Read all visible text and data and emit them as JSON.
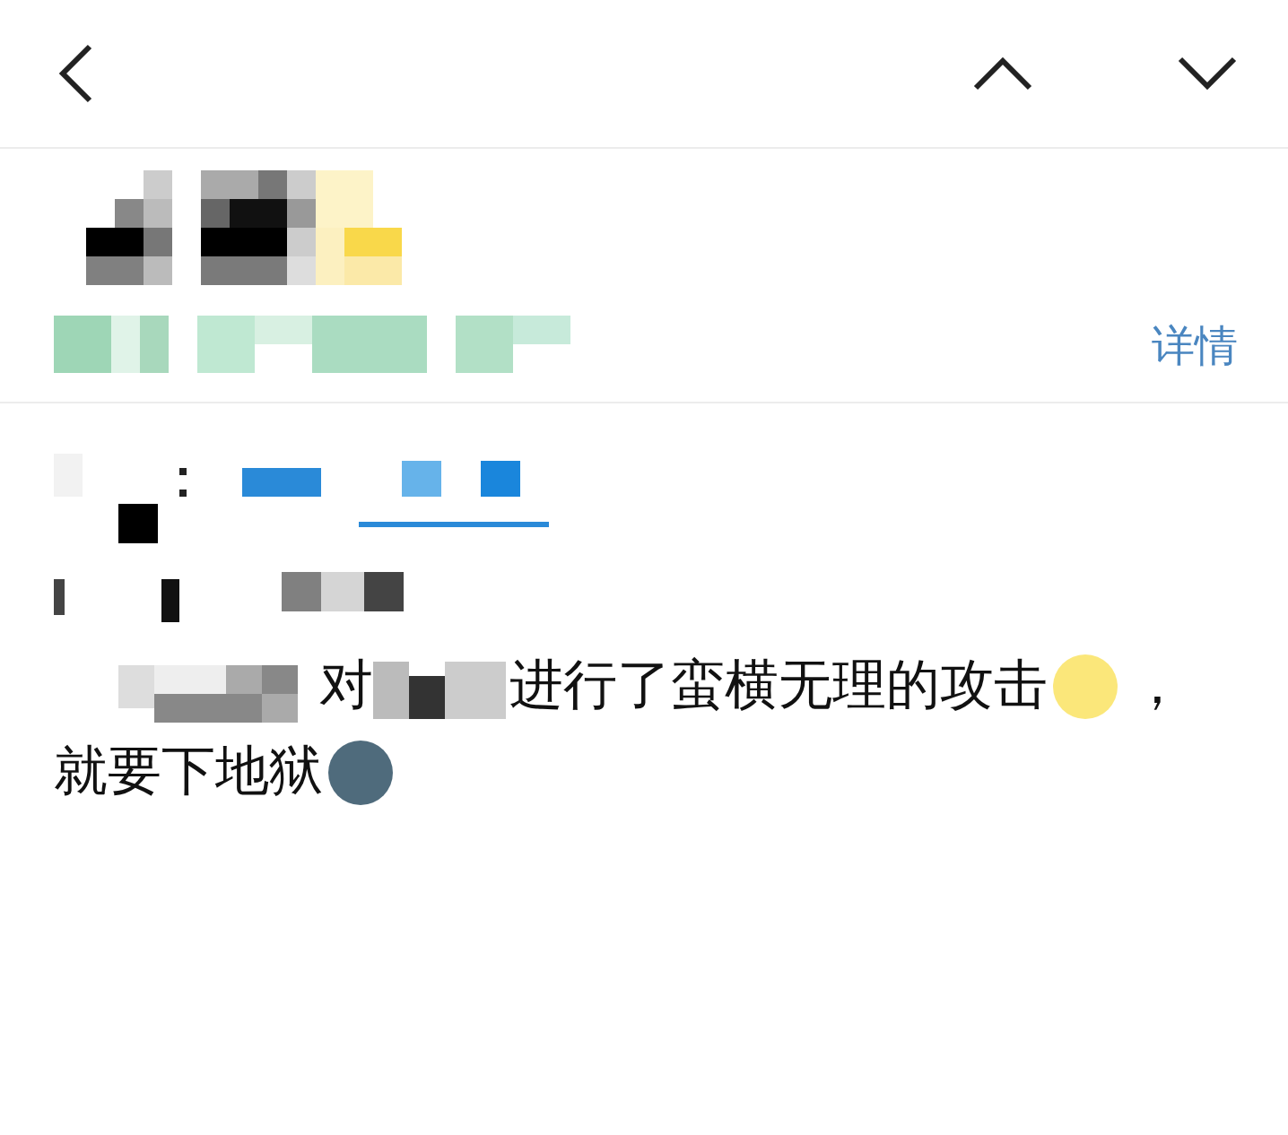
{
  "header": {
    "details_link": "详情"
  },
  "message": {
    "segment_1": "对",
    "segment_2": "进行了蛮横无理的攻击",
    "comma": "，",
    "line_4": "就要下地狱"
  }
}
